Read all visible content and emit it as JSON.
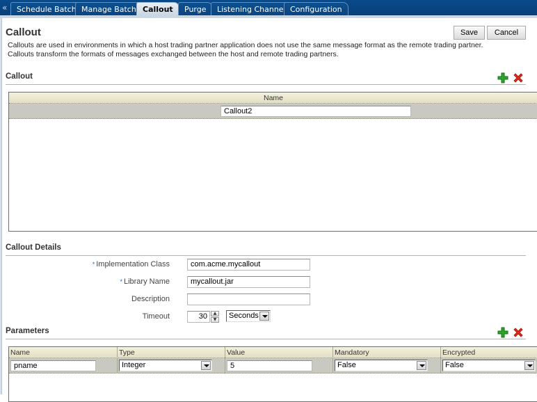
{
  "tabs": {
    "collapse_glyph": "«",
    "items": [
      {
        "label": "Schedule Batch",
        "active": false
      },
      {
        "label": "Manage Batch",
        "active": false
      },
      {
        "label": "Callout",
        "active": true
      },
      {
        "label": "Purge",
        "active": false
      },
      {
        "label": "Listening Channel",
        "active": false
      },
      {
        "label": "Configuration",
        "active": false
      }
    ]
  },
  "page": {
    "title": "Callout",
    "description_line1": "Callouts are used in environments in which a host trading partner application does not use the same message format as the remote trading partner.",
    "description_line2": "Callouts transform the formats of messages exchanged between the host and remote trading partners.",
    "save_label": "Save",
    "cancel_label": "Cancel"
  },
  "callout_section": {
    "title": "Callout",
    "add_icon": "add-icon",
    "delete_icon": "delete-icon",
    "table": {
      "column_header": "Name",
      "rows": [
        {
          "name": "Callout2"
        }
      ]
    }
  },
  "details": {
    "title": "Callout Details",
    "required_marker": "*",
    "fields": {
      "implementation_class": {
        "label": "Implementation Class",
        "value": "com.acme.mycallout",
        "required": true
      },
      "library_name": {
        "label": "Library Name",
        "value": "mycallout.jar",
        "required": true
      },
      "description": {
        "label": "Description",
        "value": "",
        "required": false
      },
      "timeout": {
        "label": "Timeout",
        "value": "30",
        "unit": "Seconds",
        "up_glyph": "▲",
        "down_glyph": "▼"
      }
    }
  },
  "parameters": {
    "title": "Parameters",
    "add_icon": "add-icon",
    "delete_icon": "delete-icon",
    "columns": [
      "Name",
      "Type",
      "Value",
      "Mandatory",
      "Encrypted"
    ],
    "rows": [
      {
        "name": "pname",
        "type": "Integer",
        "value": "5",
        "mandatory": "False",
        "encrypted": "False"
      }
    ]
  },
  "colors": {
    "tabbar": "#0a4a8a",
    "add_green": "#2aa52a",
    "delete_red": "#e02a1a",
    "row_bg": "#c9c9c1",
    "header_bg": "#ece9d2"
  }
}
